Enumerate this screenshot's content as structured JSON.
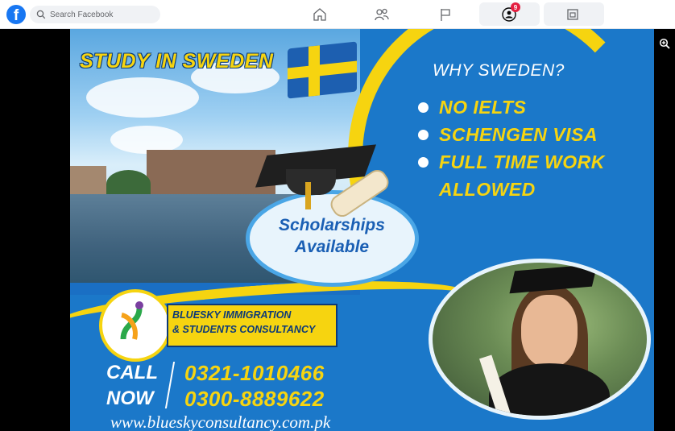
{
  "topbar": {
    "logo_letter": "f",
    "search_placeholder": "Search Facebook",
    "nav_icons": [
      "home-icon",
      "friends-icon",
      "pages-flag-icon",
      "groups-icon",
      "gaming-icon"
    ],
    "groups_badge": "9"
  },
  "viewer": {
    "zoom_icon": "zoom-in-icon"
  },
  "poster": {
    "title": "STUDY IN SWEDEN",
    "why_heading": "WHY SWEDEN?",
    "reasons": [
      "NO IELTS",
      "SCHENGEN VISA",
      "FULL TIME WORK",
      "ALLOWED"
    ],
    "scholarship_line1": "Scholarships",
    "scholarship_line2": "Available",
    "company_line1": "BLUESKY IMMIGRATION",
    "company_line2": "& STUDENTS CONSULTANCY",
    "call_line1": "CALL",
    "call_line2": "NOW",
    "phone1": "0321-1010466",
    "phone2": "0300-8889622",
    "website": "www.blueskyconsultancy.com.pk"
  },
  "colors": {
    "facebook_blue": "#1877f2",
    "poster_blue": "#1b78c9",
    "poster_yellow": "#f6d410",
    "badge_red": "#e41e3f"
  }
}
